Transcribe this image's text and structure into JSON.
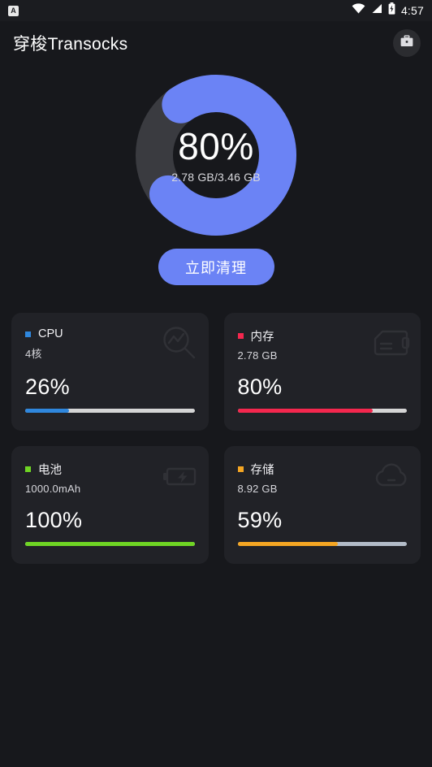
{
  "statusbar": {
    "app_badge": "A",
    "time": "4:57",
    "icons": [
      "wifi-icon",
      "signal-icon",
      "battery-charging-icon"
    ]
  },
  "appbar": {
    "title": "穿梭Transocks",
    "action_icon": "briefcase-icon"
  },
  "donut": {
    "percent_label": "80%",
    "percent_value": 80,
    "detail": "2.78 GB/3.46 GB",
    "used_gb": "2.78 GB",
    "total_gb": "3.46 GB",
    "arc_color": "#6b83f5",
    "track_color": "#3a3b40"
  },
  "clean_button": {
    "label": "立即清理",
    "color": "#6b83f5"
  },
  "cards": [
    {
      "key": "cpu",
      "title": "CPU",
      "subtitle": "4核",
      "percent_label": "26%",
      "percent_value": 26,
      "accent": "#2f87dd",
      "track": "#d5d5d5",
      "icon": "activity-magnifier-icon"
    },
    {
      "key": "memory",
      "title": "内存",
      "subtitle": "2.78 GB",
      "percent_label": "80%",
      "percent_value": 80,
      "accent": "#f4274e",
      "track": "#d5d5d5",
      "icon": "memory-card-icon"
    },
    {
      "key": "battery",
      "title": "电池",
      "subtitle": "1000.0mAh",
      "percent_label": "100%",
      "percent_value": 100,
      "accent": "#6fd524",
      "track": "#d5d5d5",
      "icon": "battery-charging-icon"
    },
    {
      "key": "storage",
      "title": "存储",
      "subtitle": "8.92 GB",
      "percent_label": "59%",
      "percent_value": 59,
      "accent": "#f5a623",
      "track": "#b3bcc8",
      "icon": "cloud-icon"
    }
  ]
}
